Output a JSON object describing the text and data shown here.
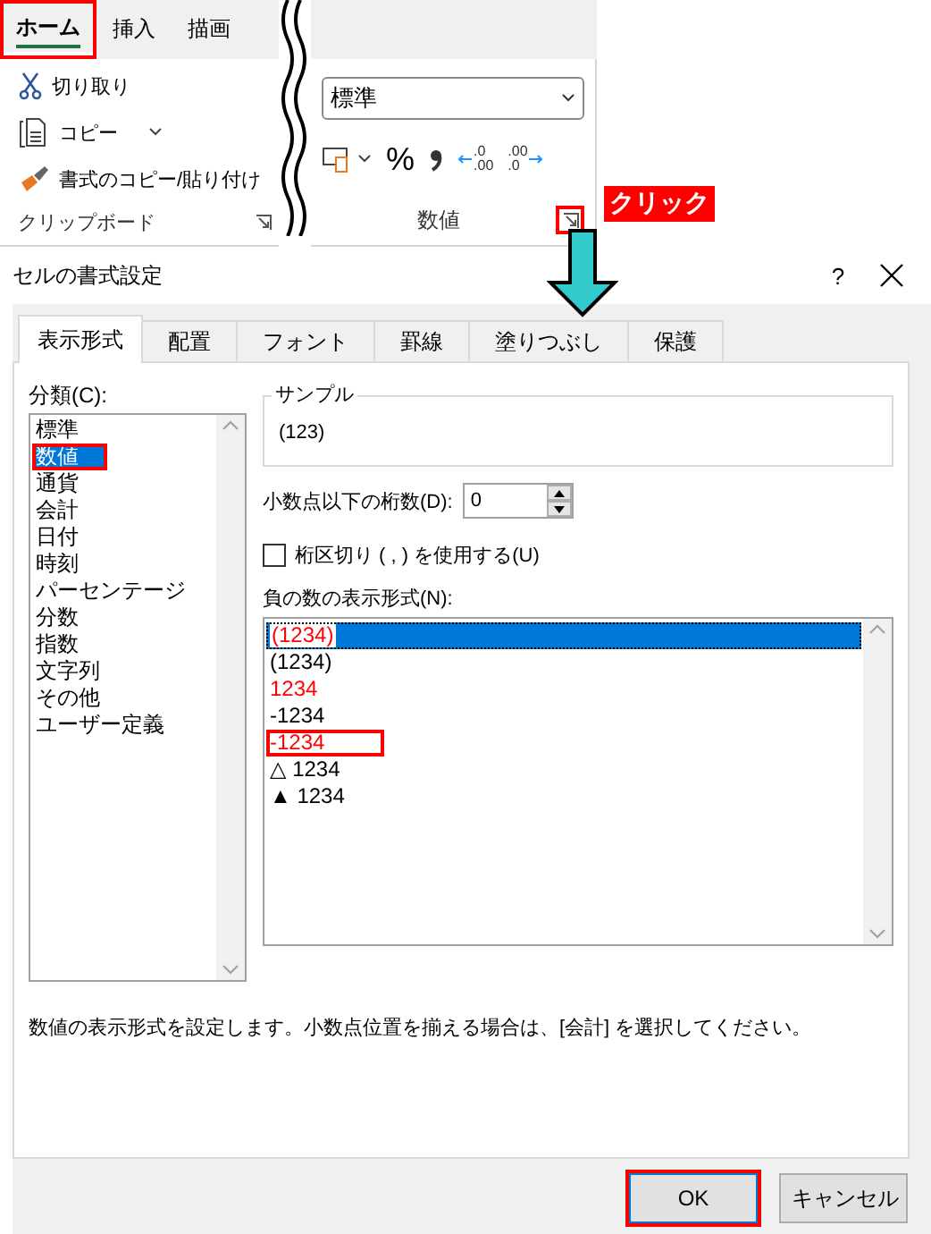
{
  "ribbon": {
    "tabs": [
      {
        "label": "ホーム",
        "selected": true,
        "highlighted": true
      },
      {
        "label": "挿入",
        "selected": false,
        "highlighted": false
      },
      {
        "label": "描画",
        "selected": false,
        "highlighted": false
      }
    ],
    "clipboard": {
      "items": [
        {
          "kind": "cut",
          "label": "切り取り",
          "dropdown": false
        },
        {
          "kind": "copy",
          "label": "コピー",
          "dropdown": true
        },
        {
          "kind": "painter",
          "label": "書式のコピー/貼り付け",
          "dropdown": false
        }
      ],
      "group_label": "クリップボード"
    },
    "number": {
      "format_value": "標準",
      "percent": "%",
      "decimal_buttons": [
        {
          "kind": "decrease",
          "top": ".0",
          "bottom": ".00"
        },
        {
          "kind": "increase",
          "top": ".00",
          "bottom": ".0"
        }
      ],
      "group_label": "数値",
      "launcher_highlighted": true
    }
  },
  "callout": "クリック",
  "dialog": {
    "title": "セルの書式設定",
    "help": "?",
    "tabs": [
      {
        "label": "表示形式",
        "selected": true
      },
      {
        "label": "配置",
        "selected": false
      },
      {
        "label": "フォント",
        "selected": false
      },
      {
        "label": "罫線",
        "selected": false
      },
      {
        "label": "塗りつぶし",
        "selected": false
      },
      {
        "label": "保護",
        "selected": false
      }
    ],
    "category_label": "分類(C):",
    "categories": [
      {
        "label": "標準",
        "selected": false,
        "highlighted": false
      },
      {
        "label": "数値",
        "selected": true,
        "highlighted": true
      },
      {
        "label": "通貨",
        "selected": false,
        "highlighted": false
      },
      {
        "label": "会計",
        "selected": false,
        "highlighted": false
      },
      {
        "label": "日付",
        "selected": false,
        "highlighted": false
      },
      {
        "label": "時刻",
        "selected": false,
        "highlighted": false
      },
      {
        "label": "パーセンテージ",
        "selected": false,
        "highlighted": false
      },
      {
        "label": "分数",
        "selected": false,
        "highlighted": false
      },
      {
        "label": "指数",
        "selected": false,
        "highlighted": false
      },
      {
        "label": "文字列",
        "selected": false,
        "highlighted": false
      },
      {
        "label": "その他",
        "selected": false,
        "highlighted": false
      },
      {
        "label": "ユーザー定義",
        "selected": false,
        "highlighted": false
      }
    ],
    "sample": {
      "legend": "サンプル",
      "value": "(123)"
    },
    "decimal_places": {
      "label": "小数点以下の桁数(D):",
      "value": "0"
    },
    "separator": {
      "label": "桁区切り ( , ) を使用する(U)",
      "checked": false
    },
    "negative": {
      "label": "負の数の表示形式(N):",
      "items": [
        {
          "text": "(1234)",
          "color": "#ff0000",
          "selected": true,
          "highlighted": false
        },
        {
          "text": "(1234)",
          "color": "#000000",
          "selected": false,
          "highlighted": false
        },
        {
          "text": "1234",
          "color": "#ff0000",
          "selected": false,
          "highlighted": false
        },
        {
          "text": "-1234",
          "color": "#000000",
          "selected": false,
          "highlighted": false
        },
        {
          "text": "-1234",
          "color": "#ff0000",
          "selected": false,
          "highlighted": true
        },
        {
          "text": "△ 1234",
          "color": "#000000",
          "selected": false,
          "highlighted": false
        },
        {
          "text": "▲ 1234",
          "color": "#000000",
          "selected": false,
          "highlighted": false
        }
      ]
    },
    "description": "数値の表示形式を設定します。小数点位置を揃える場合は、[会計] を選択してください。",
    "buttons": [
      {
        "label": "OK",
        "kind": "default",
        "highlighted": true
      },
      {
        "label": "キャンセル",
        "kind": "normal",
        "highlighted": false
      }
    ]
  }
}
